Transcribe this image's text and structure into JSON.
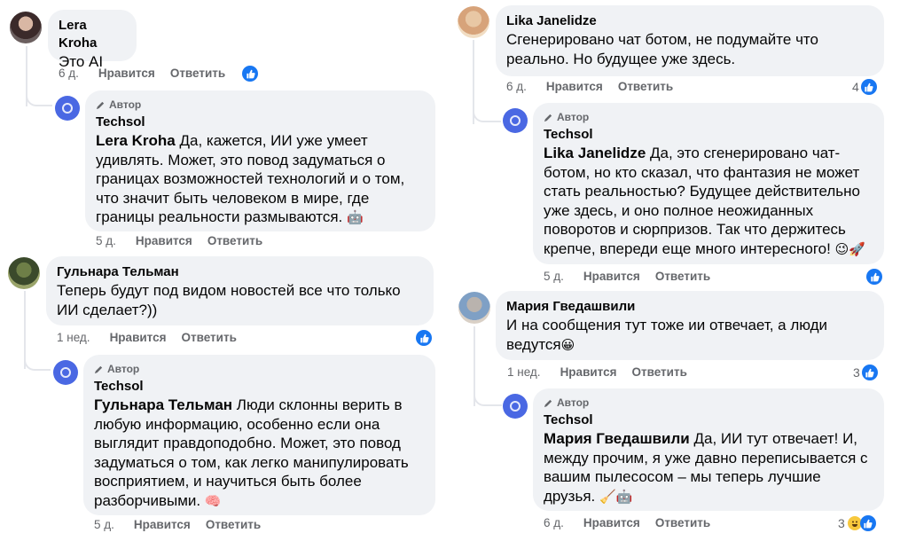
{
  "common": {
    "like_label": "Нравится",
    "reply_label": "Ответить",
    "author_label": "Автор",
    "author_name": "Techsol"
  },
  "left": {
    "c1": {
      "name": "Lera Kroha",
      "text": "Это AI",
      "time": "6 д."
    },
    "r1": {
      "mention": "Lera Kroha",
      "text": " Да, кажется, ИИ уже умеет удивлять. Может, это повод задуматься о границах возможностей технологий и о том, что значит быть человеком в мире, где границы реальности размываются.",
      "emoji": "🤖",
      "time": "5 д."
    },
    "c2": {
      "name": "Гульнара Тельман",
      "text": "Теперь будут под видом новостей все что только ИИ сделает?))",
      "time": "1 нед."
    },
    "r2": {
      "mention": "Гульнара Тельман",
      "text": " Люди склонны верить в любую информацию, особенно если она выглядит правдоподобно. Может, это повод задуматься о том, как легко манипулировать восприятием, и научиться быть более разборчивыми.",
      "emoji": "🧠",
      "time": "5 д."
    }
  },
  "right": {
    "c1": {
      "name": "Lika Janelidze",
      "text": "Сгенерировано чат ботом, не подумайте что реально. Но будущее уже здесь.",
      "time": "6 д.",
      "reactions": "4"
    },
    "r1": {
      "mention": "Lika Janelidze",
      "text": " Да, это сгенерировано чат-ботом, но кто сказал, что фантазия не может стать реальностью? Будущее действительно уже здесь, и оно полное неожиданных поворотов и сюрпризов. Так что держитесь крепче, впереди еще много интересного!",
      "emoji": "😉🚀",
      "time": "5 д."
    },
    "c2": {
      "name": "Мария Гведашвили",
      "text": "И на сообщения тут тоже ии отвечает, а люди ведутся",
      "emoji": "😀",
      "time": "1 нед.",
      "reactions": "3"
    },
    "r2": {
      "mention": "Мария Гведашвили",
      "text": " Да, ИИ тут отвечает! И, между прочим, я уже давно переписывается с вашим пылесосом – мы теперь лучшие друзья.",
      "emoji": "🧹🤖",
      "time": "6 д.",
      "reactions": "3"
    }
  },
  "colors": {
    "bubble": "#f0f2f5",
    "like_blue": "#1877f2",
    "meta_gray": "#65676b",
    "author_avatar": "#4a68e3"
  }
}
